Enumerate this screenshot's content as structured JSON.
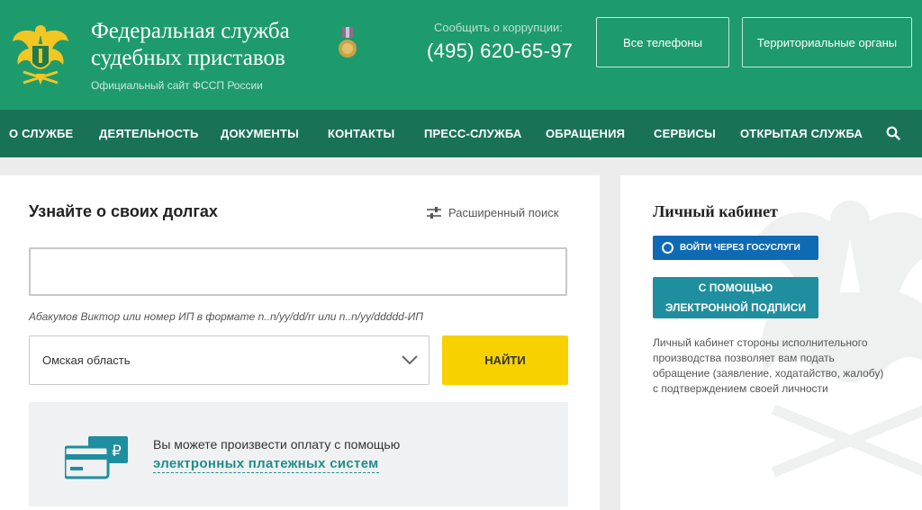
{
  "header": {
    "title_line1": "Федеральная служба",
    "title_line2": "судебных приставов",
    "subtitle": "Официальный сайт ФССП России",
    "corruption_label": "Сообщить о коррупции:",
    "corruption_phone": "(495) 620-65-97",
    "btn_phones": "Все телефоны",
    "btn_territorial": "Территориальные органы",
    "colors": {
      "brand": "#1e9b6c",
      "nav": "#1a7256"
    }
  },
  "nav": {
    "items": [
      "О СЛУЖБЕ",
      "ДЕЯТЕЛЬНОСТЬ",
      "ДОКУМЕНТЫ",
      "КОНТАКТЫ",
      "ПРЕСС-СЛУЖБА",
      "ОБРАЩЕНИЯ",
      "СЕРВИСЫ",
      "ОТКРЫТАЯ СЛУЖБА"
    ],
    "search_icon": "search-icon"
  },
  "debt": {
    "title": "Узнайте о своих долгах",
    "advanced_search": "Расширенный поиск",
    "input_value": "",
    "hint": "Абакумов Виктор или номер ИП в формате n..n/yy/dd/rr или n..n/yy/ddddd-ИП",
    "region_selected": "Омская область",
    "find_button": "НАЙТИ",
    "find_color": "#f7d100"
  },
  "payment": {
    "text": "Вы можете произвести оплату с помощью",
    "link": "электронных платежных систем",
    "icon": "payment-card-icon",
    "currency_symbol": "₽"
  },
  "cabinet": {
    "title": "Личный кабинет",
    "gosuslugi_button": "ВОЙТИ ЧЕРЕЗ ГОСУСЛУГИ",
    "signature_line1": "С ПОМОЩЬЮ",
    "signature_line2": "ЭЛЕКТРОННОЙ ПОДПИСИ",
    "description": "Личный кабинет стороны исполнительного производства позволяет вам подать обращение (заявление, ходатайство, жалобу) с подтверждением своей личности"
  }
}
